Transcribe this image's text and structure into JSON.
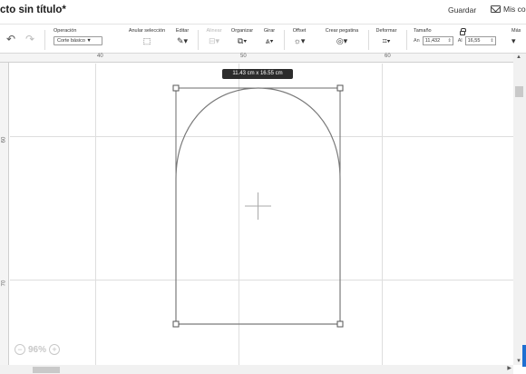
{
  "header": {
    "title": "cto sin título*",
    "save_label": "Guardar",
    "projects_label": "Mis co"
  },
  "toolbar": {
    "operation_label": "Operación",
    "operation_value": "Corte básico ▼",
    "deselect_label": "Anular selección",
    "edit_label": "Editar",
    "align_label": "Alinear",
    "organize_label": "Organizar",
    "rotate_label": "Girar",
    "offset_label": "Offset",
    "sticker_label": "Crear pegatina",
    "warp_label": "Deformar",
    "size_label": "Tamaño",
    "width_label": "An",
    "width_value": "11,432",
    "height_label": "Al",
    "height_value": "16,55",
    "more_label": "Más"
  },
  "rulers": {
    "top_40": "40",
    "top_50": "50",
    "top_60": "60",
    "left_60": "60",
    "left_70": "70"
  },
  "canvas": {
    "dimension_tooltip": "11.43  cm x 16.55  cm",
    "zoom_value": "96%"
  },
  "icons": {
    "undo": "undo-icon",
    "redo": "redo-icon",
    "mail": "mail-icon",
    "lock": "lock-icon"
  },
  "colors": {
    "shape_stroke": "#7a7a7a",
    "selection_box": "#6b6b6b",
    "tooltip_bg": "#2c2c2c",
    "accent": "#1f6fd1"
  }
}
